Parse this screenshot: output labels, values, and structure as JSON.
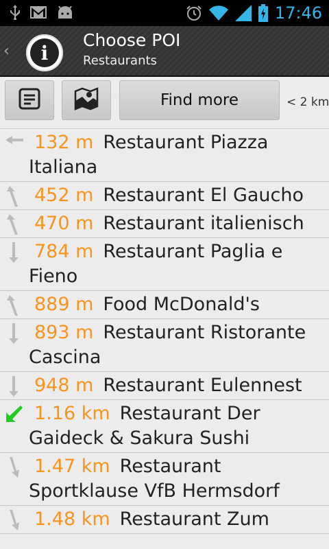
{
  "status_bar": {
    "time": "17:46",
    "icons": [
      "usb-icon",
      "gmail-icon",
      "android-icon",
      "alarm-icon",
      "wifi-icon",
      "signal-icon",
      "battery-icon"
    ],
    "accent_color": "#33b5e5"
  },
  "action_bar": {
    "title": "Choose POI",
    "subtitle": "Restaurants",
    "icons": [
      "up-caret-icon",
      "info-icon"
    ]
  },
  "toolbar": {
    "find_more_label": "Find more",
    "range_label": "< 2 km",
    "icons": [
      "notes-icon",
      "map-icon"
    ]
  },
  "colors": {
    "distance": "#f7941d",
    "arrow_gray": "#bbbbbb",
    "arrow_green": "#22cc22"
  },
  "pois": [
    {
      "distance": "132 m",
      "name": "Restaurant Piazza Italiana",
      "direction": "arrow-left-icon"
    },
    {
      "distance": "452 m",
      "name": "Restaurant El Gaucho",
      "direction": "arrow-up-icon"
    },
    {
      "distance": "470 m",
      "name": "Restaurant italienisch",
      "direction": "arrow-up-icon"
    },
    {
      "distance": "784 m",
      "name": "Restaurant Paglia e Fieno",
      "direction": "arrow-down-icon"
    },
    {
      "distance": "889 m",
      "name": "Food McDonald's",
      "direction": "arrow-up-icon"
    },
    {
      "distance": "893 m",
      "name": "Restaurant Ristorante Cascina",
      "direction": "arrow-down-icon"
    },
    {
      "distance": "948 m",
      "name": "Restaurant Eulennest",
      "direction": "arrow-down-icon"
    },
    {
      "distance": "1.16 km",
      "name": "Restaurant Der Gaideck & Sakura Sushi",
      "direction": "arrow-down-left-green-icon"
    },
    {
      "distance": "1.47 km",
      "name": "Restaurant Sportklause VfB Hermsdorf",
      "direction": "arrow-down-icon"
    },
    {
      "distance": "1.48 km",
      "name": "Restaurant Zum",
      "direction": "arrow-down-icon"
    }
  ]
}
